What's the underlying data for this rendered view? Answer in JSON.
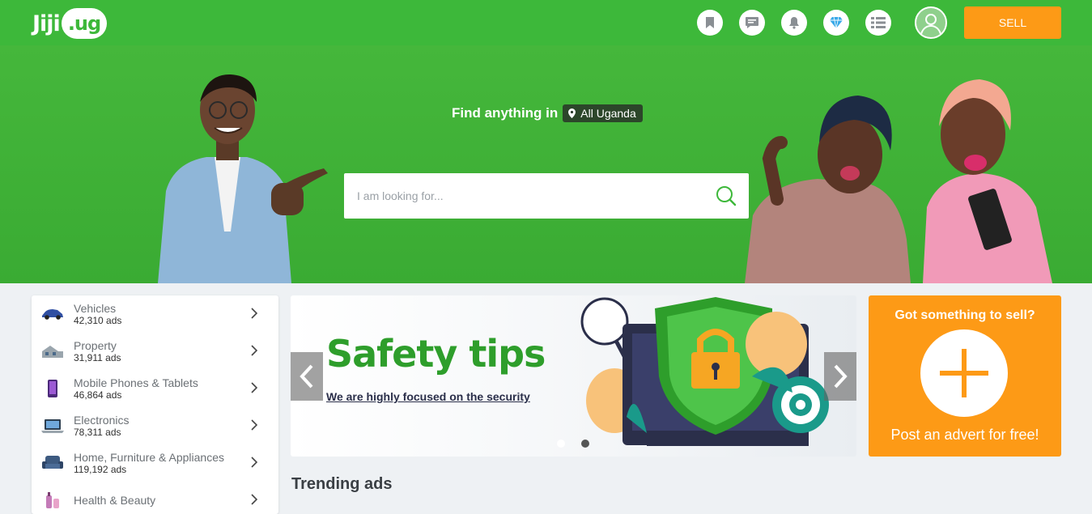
{
  "header": {
    "logo_text": "Jiji",
    "logo_domain": ".ug",
    "icons": [
      "bookmark-icon",
      "chat-icon",
      "bell-icon",
      "diamond-icon",
      "list-icon"
    ],
    "sell_label": "SELL"
  },
  "hero": {
    "find_label": "Find anything in",
    "location": "All Uganda",
    "search_placeholder": "I am looking for..."
  },
  "categories": [
    {
      "name": "Vehicles",
      "count": "42,310 ads",
      "icon": "car-icon"
    },
    {
      "name": "Property",
      "count": "31,911 ads",
      "icon": "house-icon"
    },
    {
      "name": "Mobile Phones & Tablets",
      "count": "46,864 ads",
      "icon": "phone-icon"
    },
    {
      "name": "Electronics",
      "count": "78,311 ads",
      "icon": "laptop-icon"
    },
    {
      "name": "Home, Furniture & Appliances",
      "count": "119,192 ads",
      "icon": "sofa-icon"
    },
    {
      "name": "Health & Beauty",
      "count": "",
      "icon": "cosmetics-icon"
    }
  ],
  "banner": {
    "title": "Safety tips",
    "subtitle": "We are highly focused on the security"
  },
  "sell_card": {
    "question": "Got something to sell?",
    "cta": "Post an advert for free!"
  },
  "trending_title": "Trending ads",
  "colors": {
    "brand_green": "#3db83a",
    "accent_orange": "#fd9a16"
  }
}
